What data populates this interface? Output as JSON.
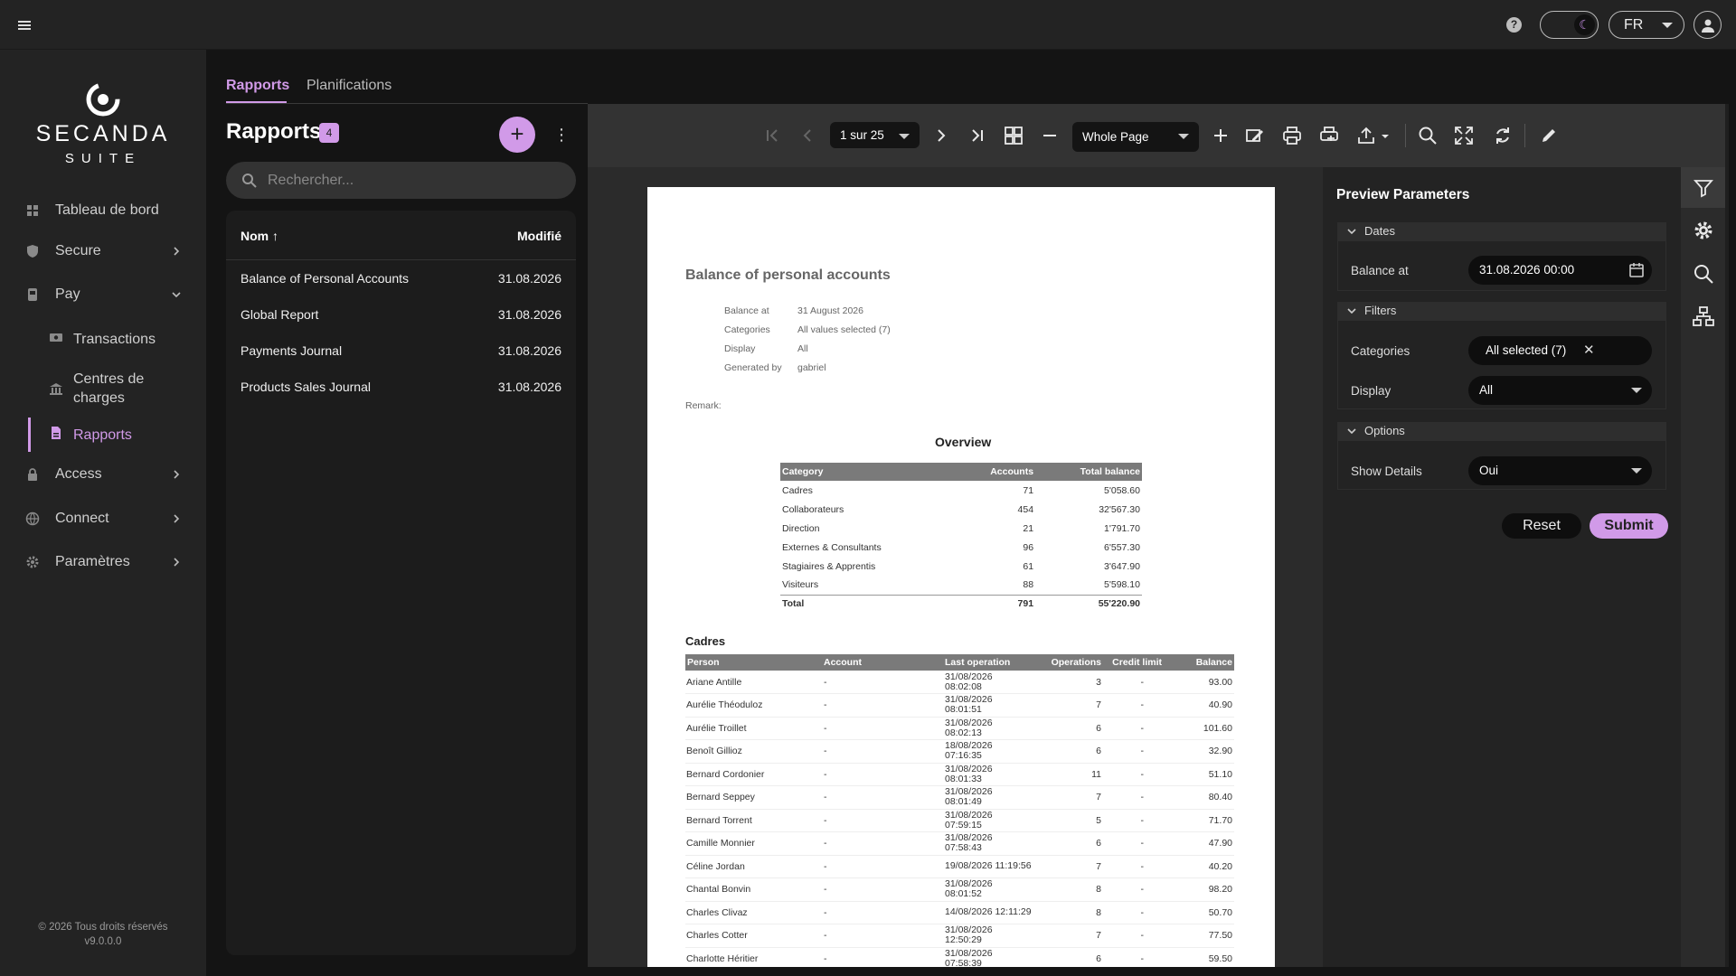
{
  "topbar": {
    "menu_icon": "hamburger-icon",
    "help_label": "?",
    "lang": "FR"
  },
  "sidebar": {
    "logo_name": "SECANDA",
    "logo_sub": "SUITE",
    "items": [
      {
        "label": "Tableau de bord",
        "icon": "dashboard-icon"
      },
      {
        "label": "Secure",
        "icon": "shield-icon"
      },
      {
        "label": "Pay",
        "icon": "pay-icon"
      },
      {
        "label": "Access",
        "icon": "lock-icon"
      },
      {
        "label": "Connect",
        "icon": "globe-icon"
      },
      {
        "label": "Paramètres",
        "icon": "gear-icon"
      }
    ],
    "sub": [
      {
        "label": "Transactions",
        "icon": "transactions-icon"
      },
      {
        "label": "Centres de charges",
        "icon": "bank-icon"
      },
      {
        "label": "Rapports",
        "icon": "report-icon"
      }
    ],
    "footer_line1": "© 2026 Tous droits réservés",
    "footer_line2": "v9.0.0.0"
  },
  "tabs": [
    {
      "label": "Rapports",
      "active": true
    },
    {
      "label": "Planifications",
      "active": false
    }
  ],
  "list": {
    "title": "Rapports",
    "count": "4",
    "add_label": "+",
    "search_placeholder": "Rechercher...",
    "col_name": "Nom",
    "sort_indicator": "↑",
    "col_modified": "Modifié",
    "rows": [
      {
        "name": "Balance of Personal Accounts",
        "date": "31.08.2026"
      },
      {
        "name": "Global Report",
        "date": "31.08.2026"
      },
      {
        "name": "Payments Journal",
        "date": "31.08.2026"
      },
      {
        "name": "Products Sales Journal",
        "date": "31.08.2026"
      }
    ]
  },
  "viewer": {
    "page_label": "1 sur 25",
    "zoom_label": "Whole Page"
  },
  "doc": {
    "title": "Balance of personal accounts",
    "meta": [
      {
        "k": "Balance at",
        "v": "31 August 2026"
      },
      {
        "k": "Categories",
        "v": "All values selected (7)"
      },
      {
        "k": "Display",
        "v": "All"
      },
      {
        "k": "Generated by",
        "v": "gabriel"
      }
    ],
    "remark": "Remark:",
    "overview_title": "Overview",
    "ov_headers": [
      "Category",
      "Accounts",
      "Total balance"
    ],
    "ov_rows": [
      [
        "Cadres",
        "71",
        "5'058.60"
      ],
      [
        "Collaborateurs",
        "454",
        "32'567.30"
      ],
      [
        "Direction",
        "21",
        "1'791.70"
      ],
      [
        "Externes & Consultants",
        "96",
        "6'557.30"
      ],
      [
        "Stagiaires & Apprentis",
        "61",
        "3'647.90"
      ],
      [
        "Visiteurs",
        "88",
        "5'598.10"
      ]
    ],
    "ov_total": [
      "Total",
      "791",
      "55'220.90"
    ],
    "section_title": "Cadres",
    "det_headers": [
      "Person",
      "Account",
      "Last operation",
      "Operations",
      "Credit limit",
      "Balance"
    ],
    "det_rows": [
      [
        "Ariane Antille",
        "-",
        "31/08/2026\n08:02:08",
        "3",
        "-",
        "93.00"
      ],
      [
        "Aurélie Théoduloz",
        "-",
        "31/08/2026\n08:01:51",
        "7",
        "-",
        "40.90"
      ],
      [
        "Aurélie Troillet",
        "-",
        "31/08/2026\n08:02:13",
        "6",
        "-",
        "101.60"
      ],
      [
        "Benoît Gillioz",
        "-",
        "18/08/2026\n07:16:35",
        "6",
        "-",
        "32.90"
      ],
      [
        "Bernard Cordonier",
        "-",
        "31/08/2026\n08:01:33",
        "11",
        "-",
        "51.10"
      ],
      [
        "Bernard Seppey",
        "-",
        "31/08/2026\n08:01:49",
        "7",
        "-",
        "80.40"
      ],
      [
        "Bernard Torrent",
        "-",
        "31/08/2026\n07:59:15",
        "5",
        "-",
        "71.70"
      ],
      [
        "Camille Monnier",
        "-",
        "31/08/2026\n07:58:43",
        "6",
        "-",
        "47.90"
      ],
      [
        "Céline Jordan",
        "-",
        "19/08/2026 11:19:56",
        "7",
        "-",
        "40.20"
      ],
      [
        "Chantal Bonvin",
        "-",
        "31/08/2026\n08:01:52",
        "8",
        "-",
        "98.20"
      ],
      [
        "Charles Clivaz",
        "-",
        "14/08/2026 12:11:29",
        "8",
        "-",
        "50.70"
      ],
      [
        "Charles Cotter",
        "-",
        "31/08/2026\n12:50:29",
        "7",
        "-",
        "77.50"
      ],
      [
        "Charlotte Héritier",
        "-",
        "31/08/2026\n07:58:39",
        "6",
        "-",
        "59.50"
      ]
    ]
  },
  "params": {
    "title": "Preview Parameters",
    "sec_dates": "Dates",
    "balance_label": "Balance at",
    "balance_value": "31.08.2026 00:00",
    "sec_filters": "Filters",
    "categories_label": "Categories",
    "categories_value": "All selected (7)",
    "display_label": "Display",
    "display_value": "All",
    "sec_options": "Options",
    "details_label": "Show Details",
    "details_value": "Oui",
    "reset": "Reset",
    "submit": "Submit"
  },
  "colors": {
    "accent": "#d19ae8",
    "bg": "#141414",
    "panel": "#232323"
  }
}
